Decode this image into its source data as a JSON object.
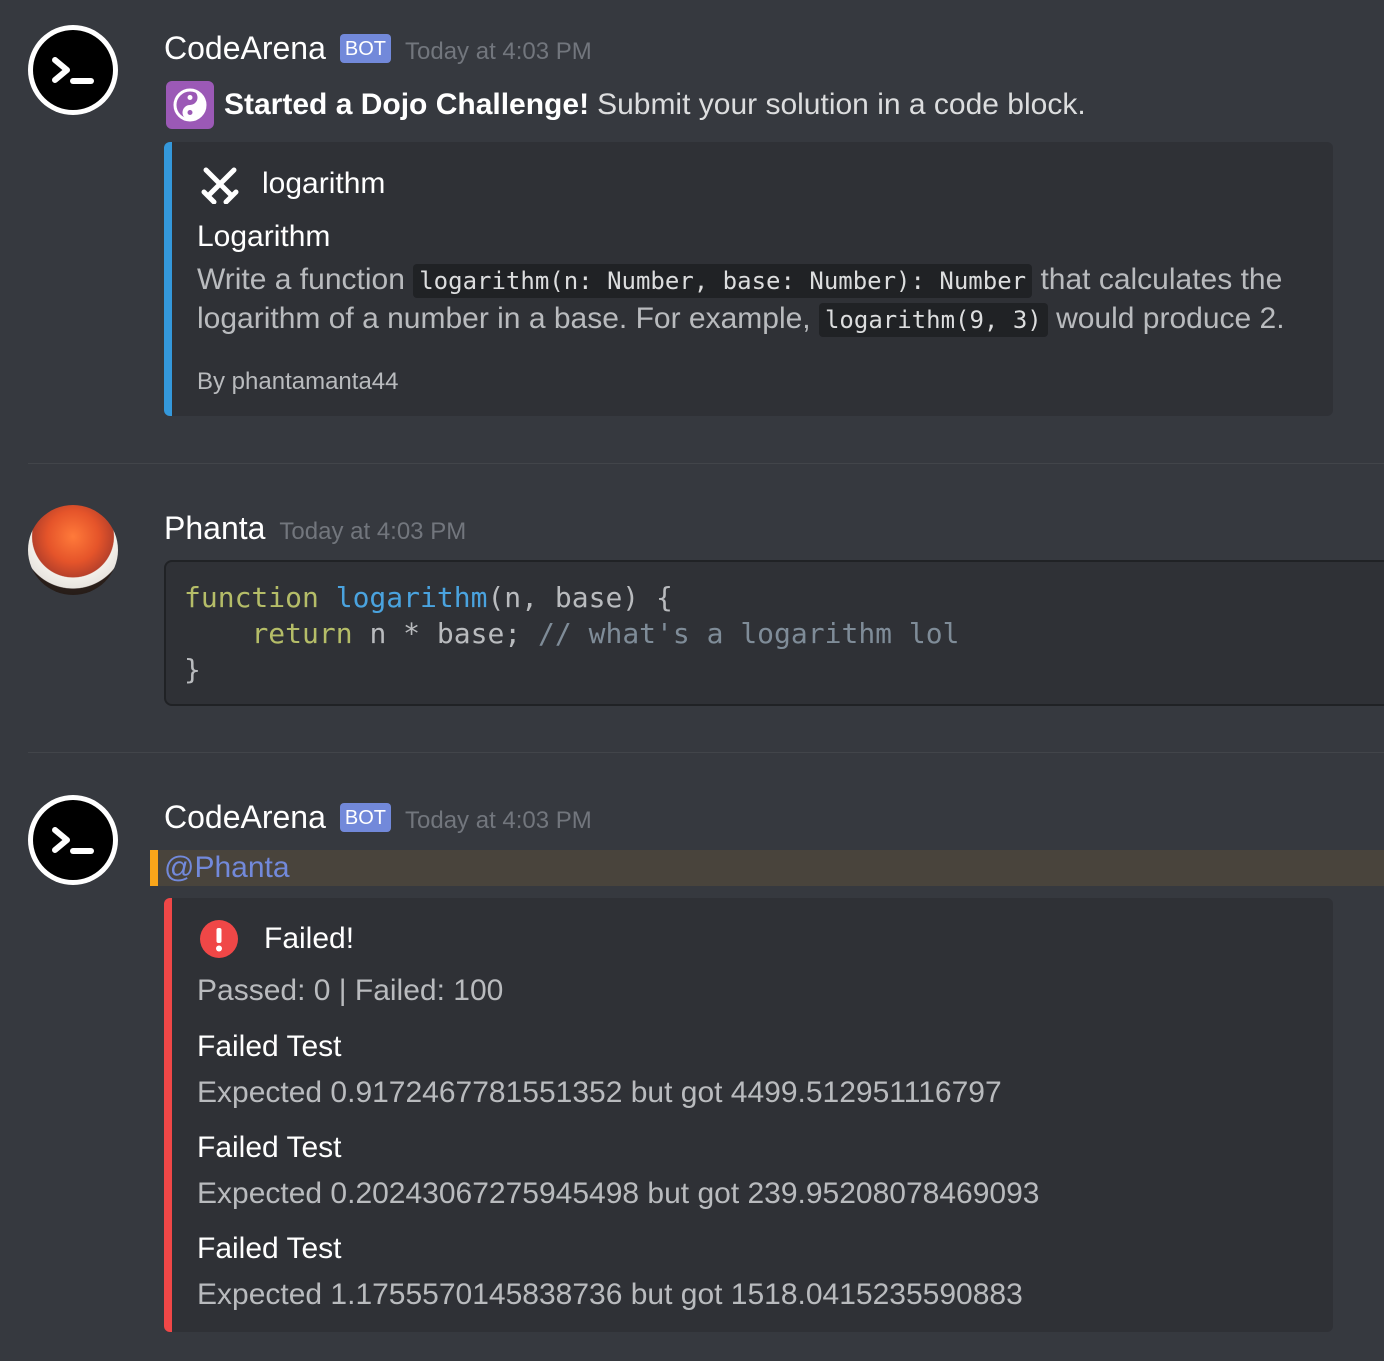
{
  "messages": [
    {
      "username": "CodeArena",
      "bot_tag": "BOT",
      "timestamp": "Today at 4:03 PM",
      "content_bold": "Started a Dojo Challenge!",
      "content_rest": "Submit your solution in a code block.",
      "embed": {
        "author": "logarithm",
        "title": "Logarithm",
        "desc_1": "Write a function",
        "code_1": "logarithm(n: Number, base: Number): Number",
        "desc_2": "that calculates the logarithm of a number in a base. For example,",
        "code_2": "logarithm(9, 3)",
        "desc_3": "would produce 2.",
        "footer": "By phantamanta44",
        "color": "#3498db"
      }
    },
    {
      "username": "Phanta",
      "timestamp": "Today at 4:03 PM",
      "code": {
        "l1_kw": "function",
        "l1_fn": "logarithm",
        "l1_rest": "(n, base) {",
        "l2_indent": "    ",
        "l2_kw": "return",
        "l2_rest": " n * base; ",
        "l2_comment": "// what's a logarithm lol",
        "l3": "}"
      }
    },
    {
      "username": "CodeArena",
      "bot_tag": "BOT",
      "timestamp": "Today at 4:03 PM",
      "mention": "@Phanta",
      "embed": {
        "title": "Failed!",
        "summary": "Passed: 0 | Failed: 100",
        "color": "#f04747",
        "fields": [
          {
            "name": "Failed Test",
            "value": "Expected 0.9172467781551352 but got 4499.512951116797"
          },
          {
            "name": "Failed Test",
            "value": "Expected 0.20243067275945498 but got 239.95208078469093"
          },
          {
            "name": "Failed Test",
            "value": "Expected 1.1755570145838736 but got 1518.0415235590883"
          }
        ]
      }
    }
  ],
  "icons": {
    "bot_avatar": "terminal-prompt-icon",
    "challenge": "yin-yang-icon",
    "embed_author": "crossed-swords-icon",
    "error": "exclamation-circle-icon"
  }
}
